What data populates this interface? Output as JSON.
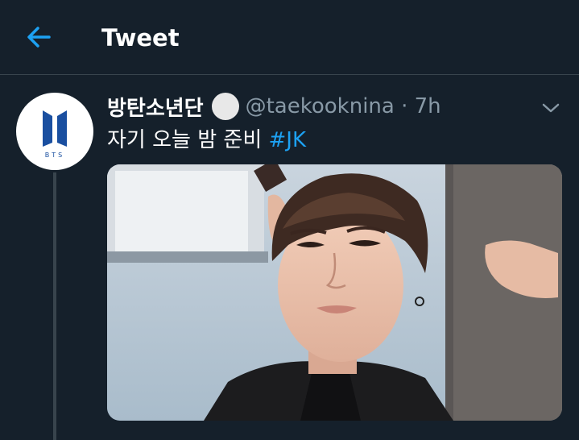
{
  "header": {
    "back_icon": "arrow-left-icon",
    "title": "Tweet"
  },
  "tweet": {
    "display_name": "방탄소년단",
    "handle_time": "@taekooknina · 7h",
    "text": "자기 오늘 밤 준비",
    "hashtag": "#JK",
    "avatar_logo_text": "BTS",
    "menu_icon": "chevron-down-icon",
    "media_description": "photo"
  },
  "colors": {
    "background": "#15202b",
    "divider": "#38444d",
    "accent": "#1da1f2",
    "secondary_text": "#8899a6",
    "bts_logo": "#1a4fa0"
  }
}
